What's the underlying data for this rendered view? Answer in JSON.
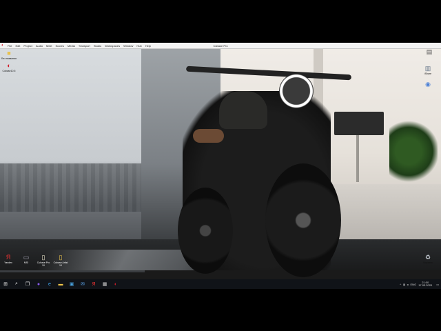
{
  "menubar": {
    "items": [
      "File",
      "Edit",
      "Project",
      "Audio",
      "MIDI",
      "Scores",
      "Media",
      "Transport",
      "Studio",
      "Workspaces",
      "Window",
      "Hub",
      "Help"
    ],
    "title": "Cubase Pro"
  },
  "desktop_icons": [
    {
      "label": "Без названия",
      "icon": "folder-icon"
    },
    {
      "label": "Cubase10.5",
      "icon": "cubase-icon"
    },
    {
      "label": "",
      "icon": "shortcut-icon"
    },
    {
      "label": "iShare",
      "icon": "ishare-icon"
    },
    {
      "label": "Yandex",
      "icon": "yandex-icon"
    },
    {
      "label": "MSI",
      "icon": "computer-icon"
    },
    {
      "label": "Cubase Pro 10",
      "icon": "file-icon"
    },
    {
      "label": "Cubase Artist 10",
      "icon": "file-icon"
    },
    {
      "label": "Корзина",
      "icon": "recycle-bin-icon"
    }
  ],
  "taskbar": {
    "items": [
      {
        "name": "start-button",
        "glyph": "⊞"
      },
      {
        "name": "search-icon",
        "glyph": "⌕"
      },
      {
        "name": "task-view-icon",
        "glyph": "❐"
      },
      {
        "name": "app-purple-icon",
        "glyph": "●"
      },
      {
        "name": "edge-icon",
        "glyph": "e"
      },
      {
        "name": "file-explorer-icon",
        "glyph": "▬"
      },
      {
        "name": "store-icon",
        "glyph": "▣"
      },
      {
        "name": "mail-icon",
        "glyph": "✉"
      },
      {
        "name": "yandex-icon",
        "glyph": "Я"
      },
      {
        "name": "calculator-icon",
        "glyph": "▦"
      },
      {
        "name": "cubase-icon",
        "glyph": "◐"
      }
    ],
    "tray": {
      "lang": "ENG",
      "time": "21:00",
      "date": "17.03.2020"
    }
  }
}
